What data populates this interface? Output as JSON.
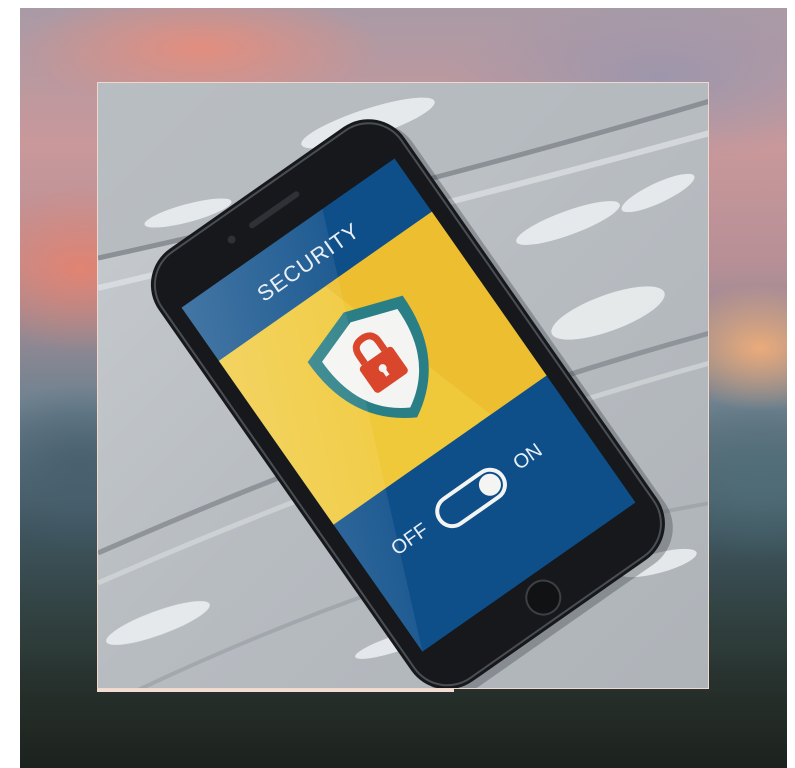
{
  "phone_screen": {
    "header_label": "SECURITY",
    "toggle_off_label": "OFF",
    "toggle_on_label": "ON",
    "toggle_state": "on"
  },
  "colors": {
    "screen_blue": "#0e4f8a",
    "screen_yellow": "#f0c93a",
    "shield_teal": "#2a7f86",
    "lock_red": "#d9462c",
    "phone_body": "#16181b"
  },
  "icons": {
    "shield": "shield-icon",
    "lock": "lock-icon",
    "toggle": "toggle-switch-icon",
    "home_button": "home-button-icon"
  }
}
